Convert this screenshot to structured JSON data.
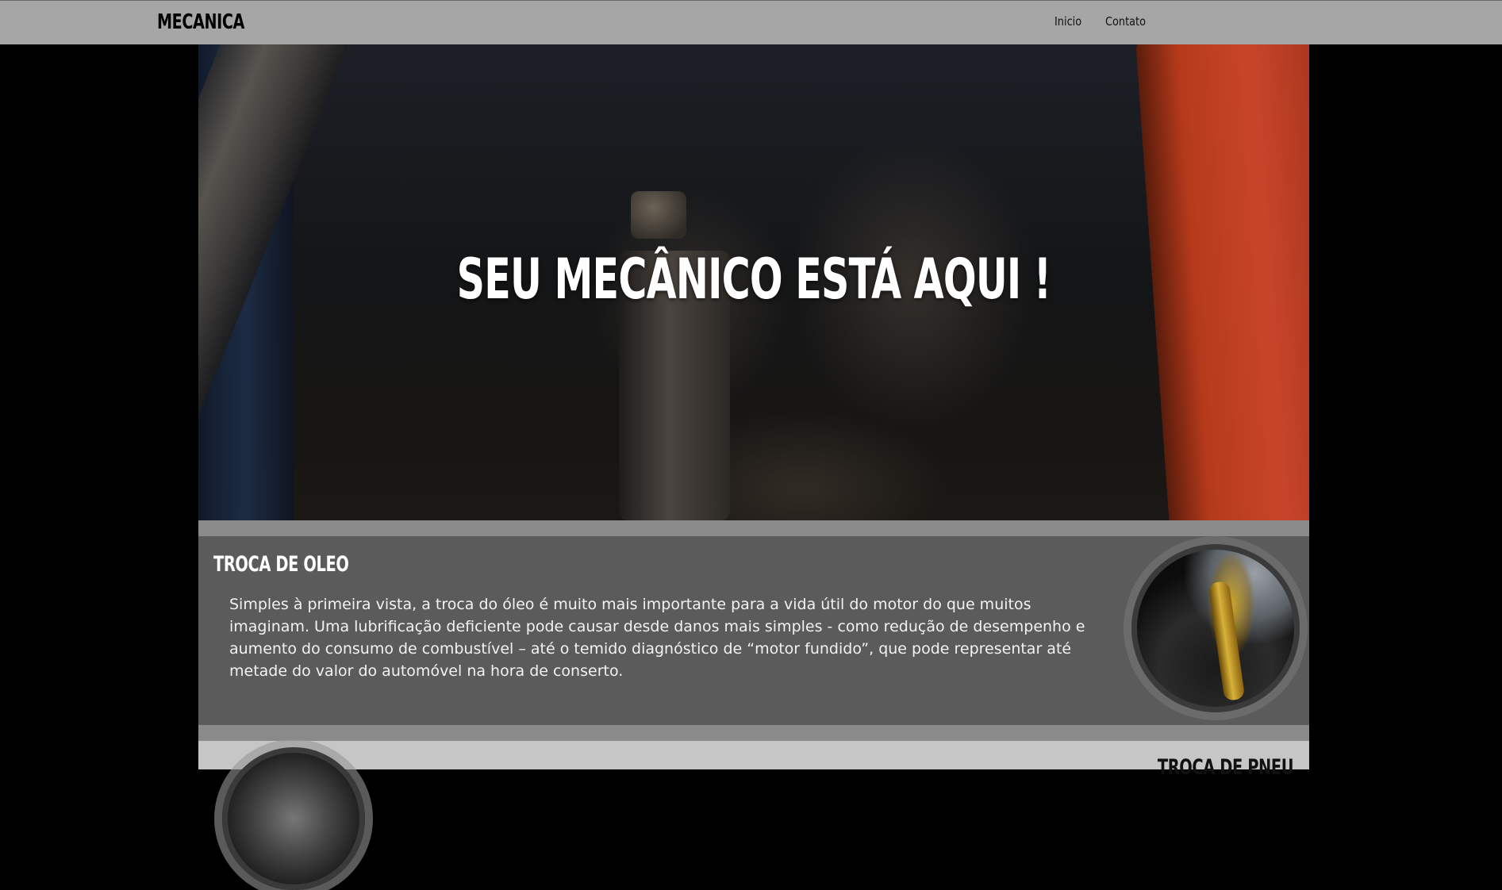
{
  "navbar": {
    "brand": "MECANICA",
    "links": [
      {
        "label": "Inicio"
      },
      {
        "label": "Contato"
      }
    ]
  },
  "hero": {
    "title": "SEU MECÂNICO ESTÁ AQUI !"
  },
  "services": [
    {
      "title": "TROCA DE OLEO",
      "text": "Simples à primeira vista, a troca do óleo é muito mais importante para a vida útil do motor do que muitos imaginam. Uma lubrificação deficiente pode causar desde danos mais simples - como redução de desempenho e aumento do consumo de combustível – até o temido diagnóstico de “motor fundido”, que pode representar até metade do valor do automóvel na hora de conserto."
    },
    {
      "title": "TROCA DE PNEU"
    }
  ],
  "colors": {
    "navbar_bg": "#a6a6a6",
    "page_bg": "#000000",
    "dark_section_bg": "#5b5b5b",
    "light_section_bg": "#c6c6c6",
    "hero_accent_red": "#c8452a"
  }
}
